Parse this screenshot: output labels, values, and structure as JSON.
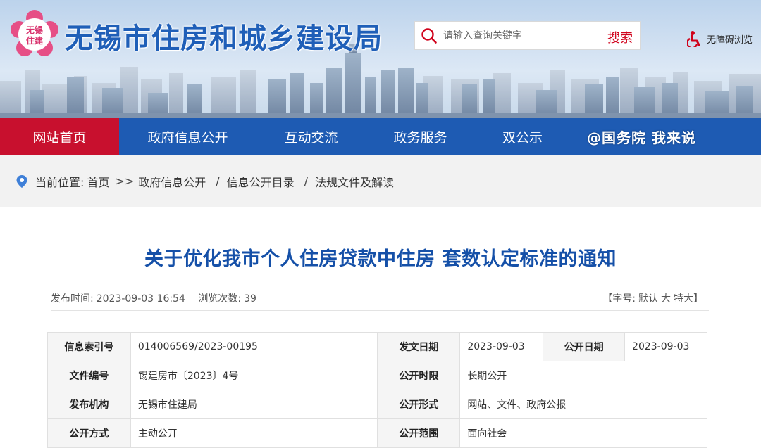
{
  "header": {
    "site_title": "无锡市住房和城乡建设局",
    "logo_text": "无锡住建",
    "search_placeholder": "请输入查询关键字",
    "search_button": "搜索",
    "accessibility": "无障碍浏览"
  },
  "nav": {
    "items": [
      {
        "label": "网站首页"
      },
      {
        "label": "政府信息公开"
      },
      {
        "label": "互动交流"
      },
      {
        "label": "政务服务"
      },
      {
        "label": "双公示"
      },
      {
        "label": "@国务院 我来说"
      }
    ],
    "colors": {
      "bar": "#1e5bb3",
      "active": "#c8102e"
    }
  },
  "breadcrumb": {
    "prefix": "当前位置:",
    "items": [
      "首页",
      "政府信息公开",
      "信息公开目录",
      "法规文件及解读"
    ],
    "sep_first": ">>",
    "sep": "/"
  },
  "article": {
    "title": "关于优化我市个人住房贷款中住房 套数认定标准的通知",
    "publish_label": "发布时间:",
    "publish_time": "2023-09-03 16:54",
    "views_label": "浏览次数:",
    "views": "39",
    "fontsize_prefix": "【字号:",
    "fontsize_default": "默认",
    "fontsize_large": "大",
    "fontsize_xlarge": "特大",
    "fontsize_suffix": "】"
  },
  "info_table": {
    "index_label": "信息索引号",
    "index_value": "014006569/2023-00195",
    "issue_date_label": "发文日期",
    "issue_date_value": "2023-09-03",
    "open_date_label": "公开日期",
    "open_date_value": "2023-09-03",
    "doc_no_label": "文件编号",
    "doc_no_value": "锡建房市〔2023〕4号",
    "term_label": "公开时限",
    "term_value": "长期公开",
    "org_label": "发布机构",
    "org_value": "无锡市住建局",
    "form_label": "公开形式",
    "form_value": "网站、文件、政府公报",
    "method_label": "公开方式",
    "method_value": "主动公开",
    "scope_label": "公开范围",
    "scope_value": "面向社会"
  }
}
